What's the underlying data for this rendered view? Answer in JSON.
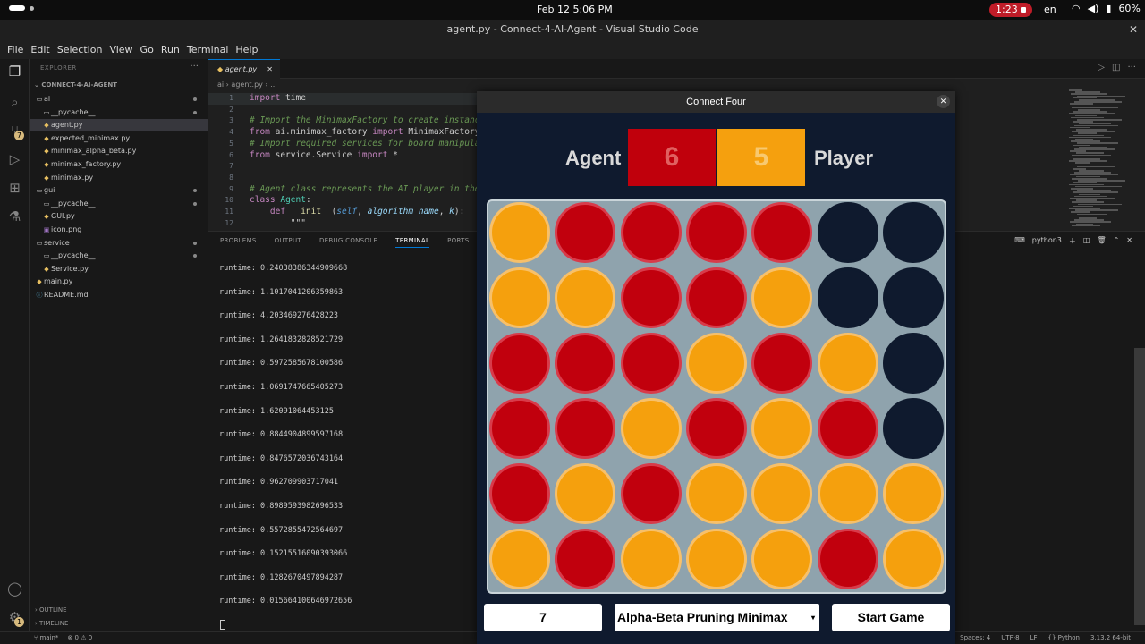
{
  "system_bar": {
    "clock": "Feb 12   5:06 PM",
    "recording_time": "1:23",
    "language": "en",
    "battery": "60%"
  },
  "window": {
    "title": "agent.py - Connect-4-AI-Agent - Visual Studio Code",
    "close": "✕"
  },
  "menu": [
    "File",
    "Edit",
    "Selection",
    "View",
    "Go",
    "Run",
    "Terminal",
    "Help"
  ],
  "explorer": {
    "header": "EXPLORER",
    "project": "CONNECT-4-AI-AGENT",
    "items": [
      {
        "label": "ai",
        "type": "folder",
        "depth": 0,
        "modified": true
      },
      {
        "label": "__pycache__",
        "type": "folder",
        "depth": 1,
        "modified": true
      },
      {
        "label": "agent.py",
        "type": "py",
        "depth": 1,
        "active": true
      },
      {
        "label": "expected_minimax.py",
        "type": "py",
        "depth": 1
      },
      {
        "label": "minimax_alpha_beta.py",
        "type": "py",
        "depth": 1
      },
      {
        "label": "minimax_factory.py",
        "type": "py",
        "depth": 1
      },
      {
        "label": "minimax.py",
        "type": "py",
        "depth": 1
      },
      {
        "label": "gui",
        "type": "folder",
        "depth": 0,
        "modified": true
      },
      {
        "label": "__pycache__",
        "type": "folder",
        "depth": 1,
        "modified": true
      },
      {
        "label": "GUI.py",
        "type": "py",
        "depth": 1
      },
      {
        "label": "icon.png",
        "type": "img",
        "depth": 1
      },
      {
        "label": "service",
        "type": "folder",
        "depth": 0,
        "modified": true
      },
      {
        "label": "__pycache__",
        "type": "folder",
        "depth": 1,
        "modified": true
      },
      {
        "label": "Service.py",
        "type": "py",
        "depth": 1
      },
      {
        "label": "main.py",
        "type": "py",
        "depth": 0
      },
      {
        "label": "README.md",
        "type": "md",
        "depth": 0
      }
    ],
    "outline": "OUTLINE",
    "timeline": "TIMELINE"
  },
  "editor": {
    "tab_label": "agent.py",
    "breadcrumb": "ai  ›  agent.py  ›  ...",
    "lines": [
      {
        "n": "1",
        "cur": true,
        "parts": [
          [
            "kw",
            "import"
          ],
          [
            "t",
            " time"
          ]
        ]
      },
      {
        "n": "2",
        "parts": []
      },
      {
        "n": "3",
        "parts": [
          [
            "cm",
            "# Import the MinimaxFactory to create instance"
          ]
        ]
      },
      {
        "n": "4",
        "parts": [
          [
            "kw",
            "from"
          ],
          [
            "t",
            " ai.minimax_factory "
          ],
          [
            "kw",
            "import"
          ],
          [
            "t",
            " MinimaxFactory"
          ]
        ]
      },
      {
        "n": "5",
        "parts": [
          [
            "cm",
            "# Import required services for board manipula"
          ]
        ]
      },
      {
        "n": "6",
        "parts": [
          [
            "kw",
            "from"
          ],
          [
            "t",
            " service.Service "
          ],
          [
            "kw",
            "import"
          ],
          [
            "t",
            " *"
          ]
        ]
      },
      {
        "n": "7",
        "parts": []
      },
      {
        "n": "8",
        "parts": []
      },
      {
        "n": "9",
        "parts": [
          [
            "cm",
            "# Agent class represents the AI player in the "
          ]
        ]
      },
      {
        "n": "10",
        "parts": [
          [
            "kw",
            "class"
          ],
          [
            "t",
            " "
          ],
          [
            "cls",
            "Agent"
          ],
          [
            "t",
            ":"
          ]
        ]
      },
      {
        "n": "11",
        "parts": [
          [
            "t",
            "    "
          ],
          [
            "kw",
            "def"
          ],
          [
            "t",
            " "
          ],
          [
            "fn",
            "__init__"
          ],
          [
            "t",
            "("
          ],
          [
            "self",
            "self"
          ],
          [
            "t",
            ", "
          ],
          [
            "pm",
            "algorithm_name"
          ],
          [
            "t",
            ", "
          ],
          [
            "pm",
            "k"
          ],
          [
            "t",
            "):"
          ]
        ]
      },
      {
        "n": "12",
        "parts": [
          [
            "t",
            "        \"\"\""
          ]
        ]
      }
    ]
  },
  "panel": {
    "tabs": [
      "PROBLEMS",
      "OUTPUT",
      "DEBUG CONSOLE",
      "TERMINAL",
      "PORTS"
    ],
    "active_tab": "TERMINAL",
    "shell": "python3",
    "terminal_lines": [
      "runtime: 0.24038386344909668",
      "runtime: 1.1017041206359863",
      "runtime: 4.203469276428223",
      "runtime: 1.2641832828521729",
      "runtime: 0.5972585678100586",
      "runtime: 1.0691747665405273",
      "runtime: 1.62091064453125",
      "runtime: 0.8844904899597168",
      "runtime: 0.8476572036743164",
      "runtime: 0.962709903717041",
      "runtime: 0.8989593982696533",
      "runtime: 0.5572855472564697",
      "runtime: 0.15215516090393066",
      "runtime: 0.1282670497894287",
      "runtime: 0.015664100646972656"
    ]
  },
  "status": {
    "branch": "main*",
    "problems": "⊗ 0  ⚠ 0",
    "right": [
      "Spaces: 4",
      "UTF-8",
      "LF",
      "{} Python",
      "3.13.2 64-bit"
    ]
  },
  "connect_four": {
    "title": "Connect Four",
    "agent_label": "Agent",
    "player_label": "Player",
    "agent_score": "6",
    "player_score": "5",
    "board": [
      [
        "Y",
        "R",
        "R",
        "R",
        "R",
        "E",
        "E"
      ],
      [
        "Y",
        "Y",
        "R",
        "R",
        "Y",
        "E",
        "E"
      ],
      [
        "R",
        "R",
        "R",
        "Y",
        "R",
        "Y",
        "E"
      ],
      [
        "R",
        "R",
        "Y",
        "R",
        "Y",
        "R",
        "E"
      ],
      [
        "R",
        "Y",
        "R",
        "Y",
        "Y",
        "Y",
        "Y"
      ],
      [
        "Y",
        "R",
        "Y",
        "Y",
        "Y",
        "R",
        "Y"
      ]
    ],
    "depth_value": "7",
    "algorithm": "Alpha-Beta Pruning Minimax",
    "start_label": "Start Game",
    "colors": {
      "agent": "#c0000c",
      "player": "#f5a00e",
      "board": "#8fa3ad",
      "background": "#0f1a2e"
    }
  }
}
